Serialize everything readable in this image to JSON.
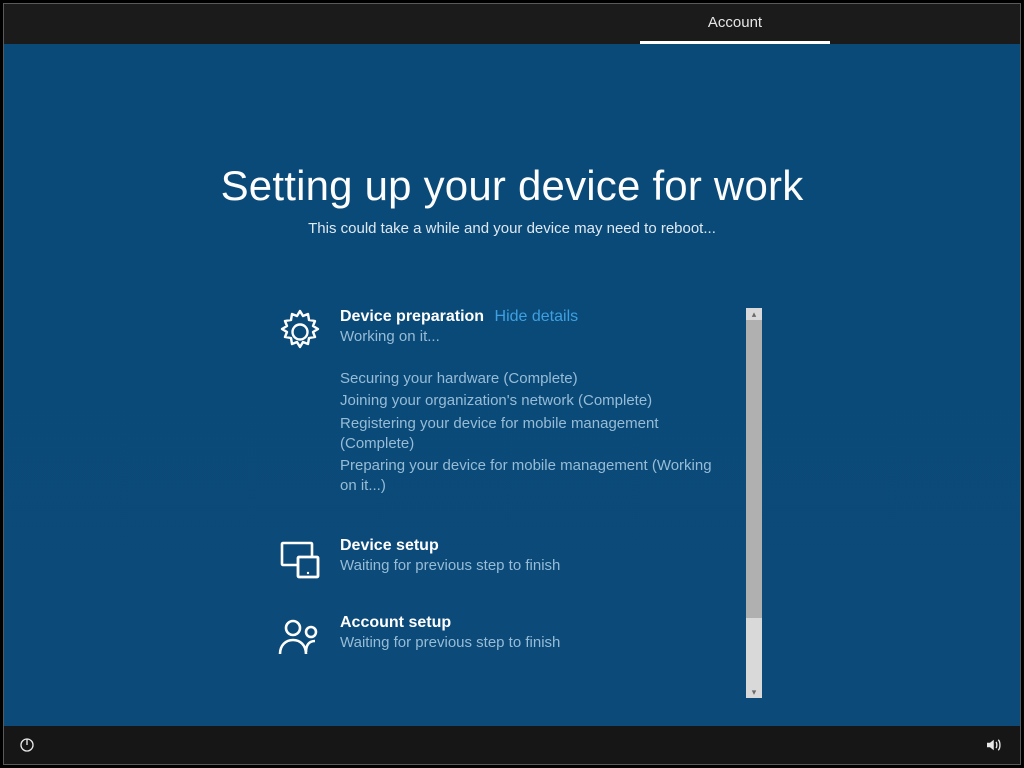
{
  "topbar": {
    "active_tab": "Account"
  },
  "main": {
    "title": "Setting up your device for work",
    "subtitle": "This could take a while and your device may need to reboot..."
  },
  "sections": {
    "device_preparation": {
      "title": "Device preparation",
      "toggle": "Hide details",
      "status": "Working on it...",
      "details": {
        "line1": "Securing your hardware (Complete)",
        "line2": "Joining your organization's network (Complete)",
        "line3": "Registering your device for mobile management (Complete)",
        "line4": "Preparing your device for mobile management (Working on it...)"
      }
    },
    "device_setup": {
      "title": "Device setup",
      "status": "Waiting for previous step to finish"
    },
    "account_setup": {
      "title": "Account setup",
      "status": "Waiting for previous step to finish"
    }
  }
}
